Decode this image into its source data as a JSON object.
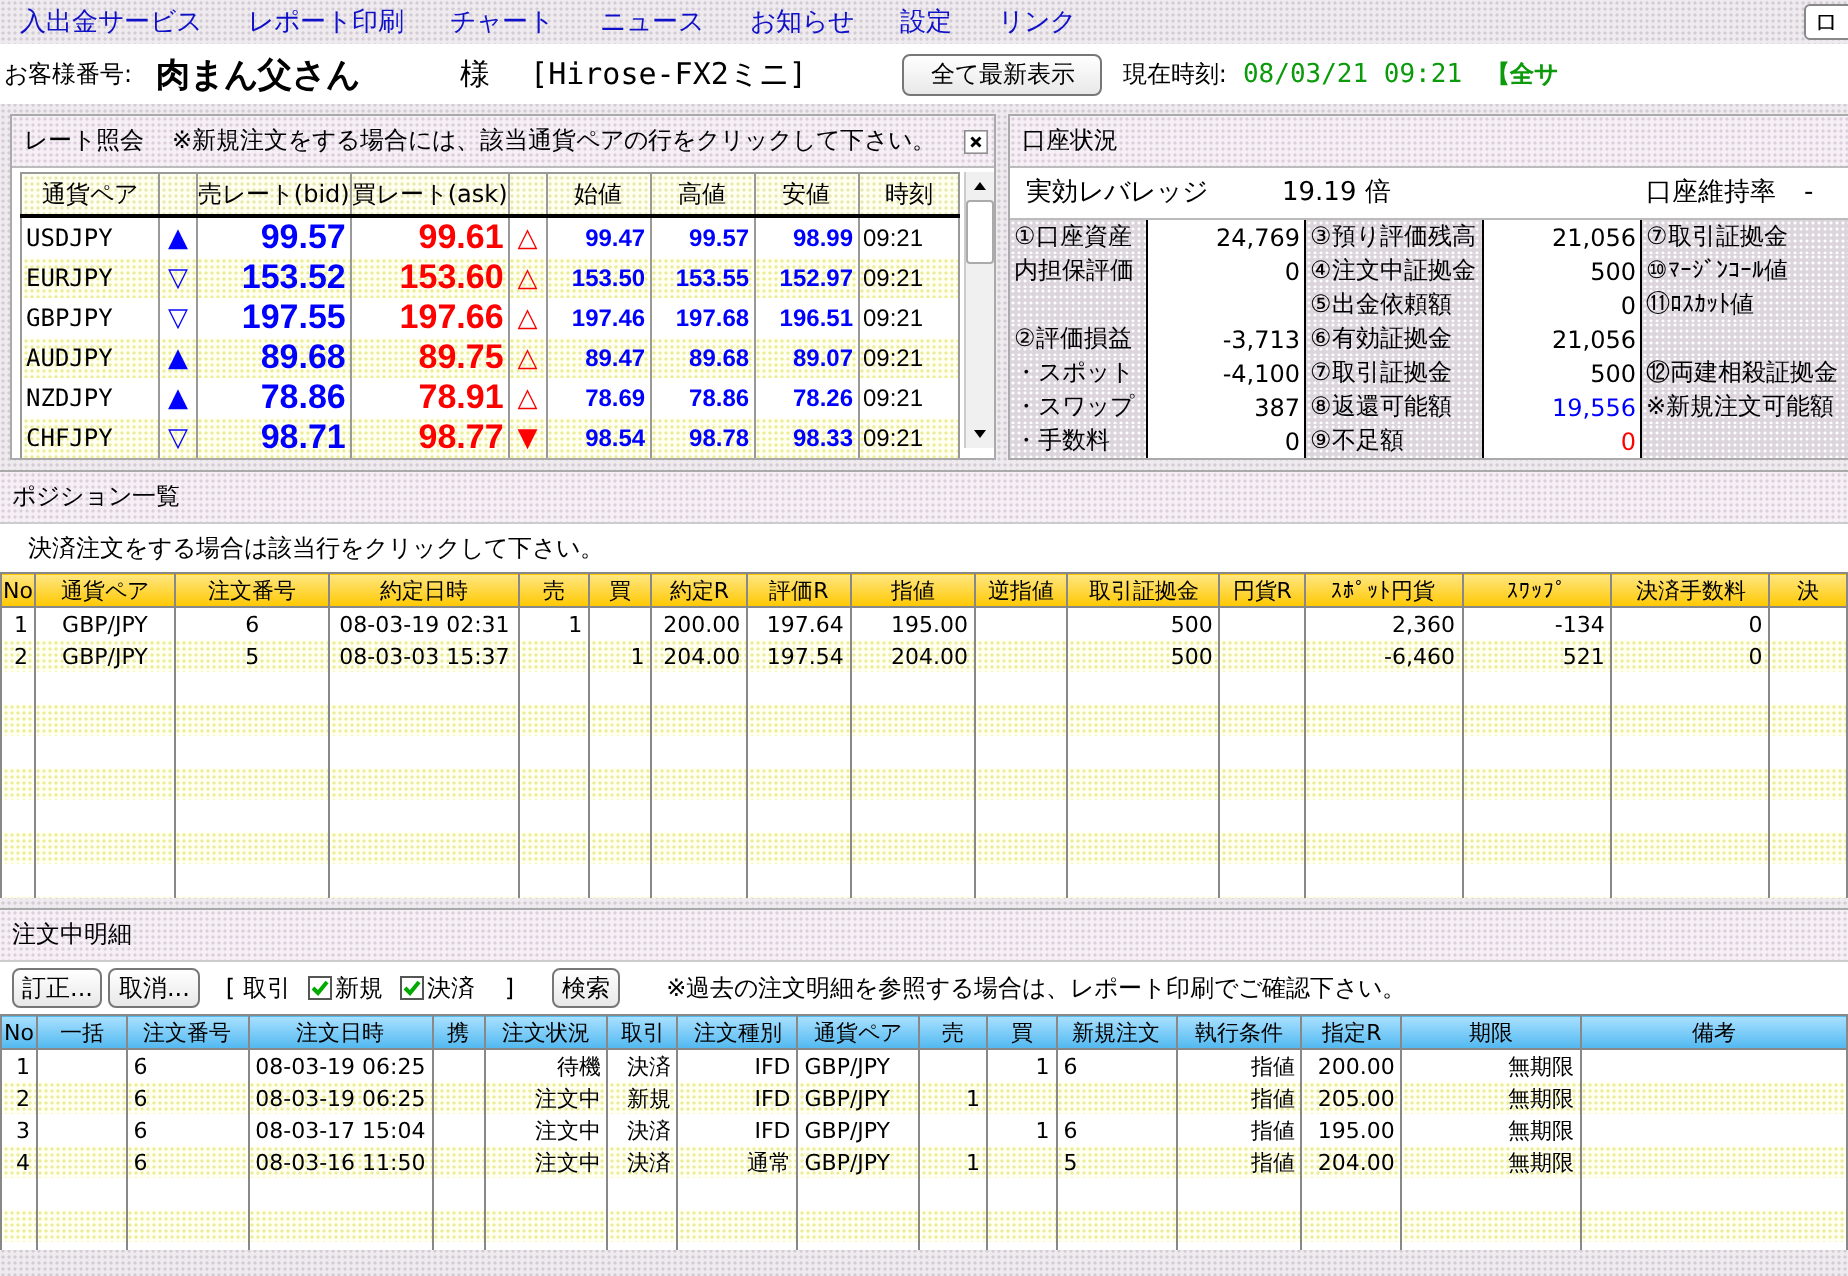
{
  "menu": [
    "入出金サービス",
    "レポート印刷",
    "チャート",
    "ニュース",
    "お知らせ",
    "設定",
    "リンク"
  ],
  "menu_button": "ロ",
  "customer": {
    "label": "お客様番号:",
    "name": "肉まん父さん",
    "honorific": "様",
    "account": "[Hirose-FX2ミニ]"
  },
  "refresh_button": "全て最新表示",
  "clock": {
    "label": "現在時刻:",
    "value": "08/03/21 09:21"
  },
  "notice": "【全サ",
  "rates": {
    "title": "レート照会",
    "hint": "※新規注文をする場合には、該当通貨ペアの行をクリックして下さい。",
    "columns": [
      "通貨ペア",
      "売レート(bid)",
      "買レート(ask)",
      "始値",
      "高値",
      "安値",
      "時刻"
    ],
    "rows": [
      {
        "pair": "USDJPY",
        "bid_mark": "▲",
        "bid": "99.57",
        "ask": "99.61",
        "ask_mark": "△",
        "open": "99.47",
        "high": "99.57",
        "low": "98.99",
        "time": "09:21"
      },
      {
        "pair": "EURJPY",
        "bid_mark": "▽",
        "bid": "153.52",
        "ask": "153.60",
        "ask_mark": "△",
        "open": "153.50",
        "high": "153.55",
        "low": "152.97",
        "time": "09:21"
      },
      {
        "pair": "GBPJPY",
        "bid_mark": "▽",
        "bid": "197.55",
        "ask": "197.66",
        "ask_mark": "△",
        "open": "197.46",
        "high": "197.68",
        "low": "196.51",
        "time": "09:21"
      },
      {
        "pair": "AUDJPY",
        "bid_mark": "▲",
        "bid": "89.68",
        "ask": "89.75",
        "ask_mark": "△",
        "open": "89.47",
        "high": "89.68",
        "low": "89.07",
        "time": "09:21"
      },
      {
        "pair": "NZDJPY",
        "bid_mark": "▲",
        "bid": "78.86",
        "ask": "78.91",
        "ask_mark": "△",
        "open": "78.69",
        "high": "78.86",
        "low": "78.26",
        "time": "09:21"
      },
      {
        "pair": "CHFJPY",
        "bid_mark": "▽",
        "bid": "98.71",
        "ask": "98.77",
        "ask_mark": "▼",
        "open": "98.54",
        "high": "98.78",
        "low": "98.33",
        "time": "09:21"
      }
    ]
  },
  "account": {
    "title": "口座状況",
    "leverage_label": "実効レバレッジ",
    "leverage": "19.19 倍",
    "maintenance_label": "口座維持率",
    "maintenance_value": "-",
    "rows": [
      [
        {
          "text": "①口座資産"
        },
        {
          "text": "24,769"
        },
        {
          "text": "③預り評価残高"
        },
        {
          "text": "21,056"
        },
        {
          "text": "⑦取引証拠金"
        }
      ],
      [
        {
          "text": "内担保評価"
        },
        {
          "text": "0"
        },
        {
          "text": "④注文中証拠金"
        },
        {
          "text": "500"
        },
        {
          "text": "⑩ﾏｰｼﾞﾝｺｰﾙ値"
        }
      ],
      [
        null,
        null,
        {
          "text": "⑤出金依頼額"
        },
        {
          "text": "0"
        },
        {
          "text": "⑪ﾛｽｶｯﾄ値"
        }
      ],
      [
        {
          "text": "②評価損益"
        },
        {
          "text": "-3,713"
        },
        {
          "text": "⑥有効証拠金"
        },
        {
          "text": "21,056"
        },
        null
      ],
      [
        {
          "text": "・スポット"
        },
        {
          "text": "-4,100"
        },
        {
          "text": "⑦取引証拠金"
        },
        {
          "text": "500"
        },
        {
          "text": "⑫両建相殺証拠金"
        }
      ],
      [
        {
          "text": "・スワップ"
        },
        {
          "text": "387"
        },
        {
          "text": "⑧返還可能額"
        },
        {
          "text": "19,556",
          "color": "#0000ff"
        },
        {
          "text": "※新規注文可能額"
        }
      ],
      [
        {
          "text": "・手数料"
        },
        {
          "text": "0"
        },
        {
          "text": "⑨不足額"
        },
        {
          "text": "0",
          "color": "#ff0000"
        },
        null
      ]
    ]
  },
  "positions": {
    "title": "ポジション一覧",
    "hint": "決済注文をする場合は該当行をクリックして下さい。",
    "columns": [
      "No",
      "通貨ペア",
      "注文番号",
      "約定日時",
      "売",
      "買",
      "約定R",
      "評価R",
      "指値",
      "逆指値",
      "取引証拠金",
      "円貨R",
      "ｽﾎﾟｯﾄ円貨",
      "ｽﾜｯﾌﾟ",
      "決済手数料",
      "決"
    ],
    "rows": [
      [
        "1",
        "GBP/JPY",
        "6",
        "08-03-19 02:31",
        "1",
        null,
        "200.00",
        "197.64",
        "195.00",
        null,
        "500",
        null,
        "2,360",
        "-134",
        "0",
        null
      ],
      [
        "2",
        "GBP/JPY",
        "5",
        "08-03-03 15:37",
        null,
        "1",
        "204.00",
        "197.54",
        "204.00",
        null,
        "500",
        null,
        "-6,460",
        "521",
        "0",
        null
      ]
    ]
  },
  "orders": {
    "title": "注文中明細",
    "buttons": [
      "訂正...",
      "取消..."
    ],
    "filter_open": "[ 取引",
    "filters": [
      {
        "label": "新規",
        "checked": true
      },
      {
        "label": "決済",
        "checked": true
      }
    ],
    "filter_close": "]",
    "search_button": "検索",
    "hint": "※過去の注文明細を参照する場合は、レポート印刷でご確認下さい。",
    "columns": [
      "No",
      "一括",
      "注文番号",
      "注文日時",
      "携",
      "注文状況",
      "取引",
      "注文種別",
      "通貨ペア",
      "売",
      "買",
      "新規注文",
      "執行条件",
      "指定R",
      "期限",
      "備考"
    ],
    "rows": [
      [
        "1",
        null,
        "6",
        "08-03-19 06:25",
        null,
        "待機",
        "決済",
        "IFD",
        "GBP/JPY",
        null,
        "1",
        "6",
        "指値",
        "200.00",
        "無期限",
        null
      ],
      [
        "2",
        null,
        "6",
        "08-03-19 06:25",
        null,
        "注文中",
        "新規",
        "IFD",
        "GBP/JPY",
        "1",
        null,
        null,
        "指値",
        "205.00",
        "無期限",
        null
      ],
      [
        "3",
        null,
        "6",
        "08-03-17 15:04",
        null,
        "注文中",
        "決済",
        "IFD",
        "GBP/JPY",
        null,
        "1",
        "6",
        "指値",
        "195.00",
        "無期限",
        null
      ],
      [
        "4",
        null,
        "6",
        "08-03-16 11:50",
        null,
        "注文中",
        "決済",
        "通常",
        "GBP/JPY",
        "1",
        null,
        "5",
        "指値",
        "204.00",
        "無期限",
        null
      ]
    ]
  }
}
